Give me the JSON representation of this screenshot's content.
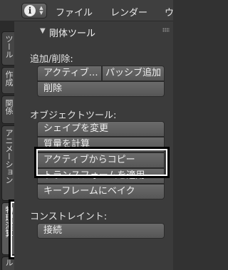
{
  "header": {
    "editor_type_icon": "info-icon",
    "menu": [
      "ファイル",
      "レンダー",
      "ウ"
    ]
  },
  "tabs": [
    "ツール",
    "作成",
    "関係",
    "アニメーション",
    "物理演算",
    "ル"
  ],
  "active_tab": "物理演算",
  "panel": {
    "title": "剛体ツール",
    "add_remove_label": "追加/削除:",
    "active_btn": "アクティブ…",
    "passive_btn": "パッシブ追加",
    "delete_btn": "削除",
    "object_tools_label": "オブジェクトツール:",
    "change_shape_btn": "シェイプを変更",
    "calc_mass_btn": "質量を計算",
    "copy_from_active_btn": "アクティブからコピー",
    "apply_transform_btn": "トランスフォームを適用",
    "bake_keyframes_btn": "キーフレームにベイク",
    "constraint_label": "コンストレイント:",
    "connect_btn": "接続"
  }
}
